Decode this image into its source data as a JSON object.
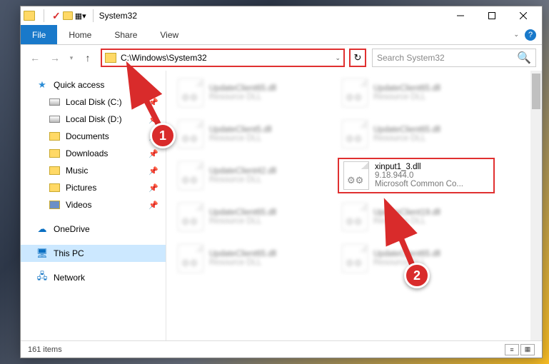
{
  "window": {
    "title": "System32"
  },
  "ribbon": {
    "file": "File",
    "home": "Home",
    "share": "Share",
    "view": "View"
  },
  "nav": {
    "address": "C:\\Windows\\System32",
    "search_placeholder": "Search System32"
  },
  "sidebar": {
    "quick_access": "Quick access",
    "items": [
      {
        "label": "Local Disk (C:)"
      },
      {
        "label": "Local Disk (D:)"
      },
      {
        "label": "Documents"
      },
      {
        "label": "Downloads"
      },
      {
        "label": "Music"
      },
      {
        "label": "Pictures"
      },
      {
        "label": "Videos"
      }
    ],
    "onedrive": "OneDrive",
    "this_pc": "This PC",
    "network": "Network"
  },
  "files": {
    "blurred": [
      {
        "name": "UpdateClient65.dll",
        "sub": "Resource DLL"
      },
      {
        "name": "UpdateClient65.dll",
        "sub": "Resource DLL"
      },
      {
        "name": "UpdateClient5.dll",
        "sub": "Resource DLL"
      },
      {
        "name": "UpdateClient65.dll",
        "sub": "Resource DLL"
      },
      {
        "name": "UpdateClient42.dll",
        "sub": "Resource DLL"
      }
    ],
    "target": {
      "name": "xinput1_3.dll",
      "version": "9.18.944.0",
      "desc": "Microsoft Common Co..."
    },
    "rest": [
      {
        "name": "UpdateClient65.dll",
        "sub": "Resource DLL"
      },
      {
        "name": "UpdateClient19.dll",
        "sub": "Resource DLL"
      },
      {
        "name": "UpdateClient65.dll",
        "sub": "Resource DLL"
      },
      {
        "name": "UpdateClient65.dll",
        "sub": "Resource DLL"
      }
    ]
  },
  "status": {
    "count": "161 items"
  },
  "annotations": {
    "one": "1",
    "two": "2"
  }
}
